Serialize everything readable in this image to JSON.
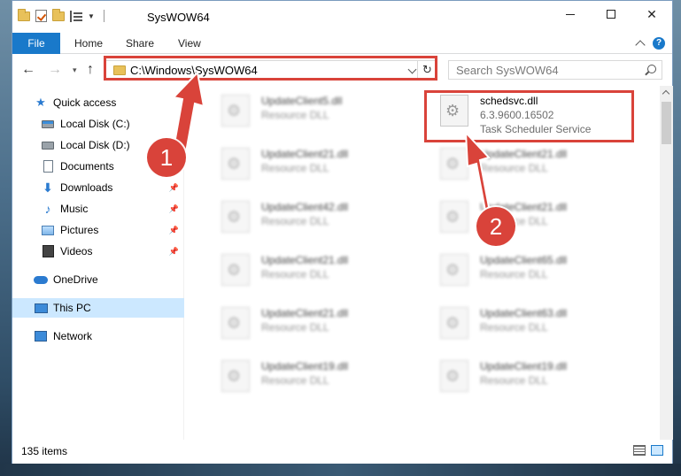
{
  "window": {
    "title": "SysWOW64",
    "controls": {
      "minimize": "",
      "maximize": "",
      "close": "✕"
    }
  },
  "ribbon": {
    "tabs": [
      {
        "label": "File"
      },
      {
        "label": "Home"
      },
      {
        "label": "Share"
      },
      {
        "label": "View"
      }
    ],
    "help": "?"
  },
  "address": {
    "path": "C:\\Windows\\SysWOW64",
    "refresh": "↻"
  },
  "search": {
    "placeholder": "Search SysWOW64"
  },
  "nav": {
    "back": "←",
    "forward": "→",
    "recent": "▾",
    "up": "↑",
    "items": [
      {
        "label": "Quick access",
        "icon": "star-icon"
      },
      {
        "label": "Local Disk (C:)",
        "icon": "disk-icon"
      },
      {
        "label": "Local Disk (D:)",
        "icon": "disk-icon"
      },
      {
        "label": "Documents",
        "icon": "document-icon"
      },
      {
        "label": "Downloads",
        "icon": "download-icon",
        "pinned": true
      },
      {
        "label": "Music",
        "icon": "music-icon",
        "pinned": true
      },
      {
        "label": "Pictures",
        "icon": "pictures-icon",
        "pinned": true
      },
      {
        "label": "Videos",
        "icon": "videos-icon",
        "pinned": true
      },
      {
        "label": "OneDrive",
        "icon": "cloud-icon"
      },
      {
        "label": "This PC",
        "icon": "pc-icon",
        "selected": true
      },
      {
        "label": "Network",
        "icon": "network-icon"
      }
    ]
  },
  "files": {
    "highlighted": {
      "name": "schedsvc.dll",
      "version": "6.3.9600.16502",
      "description": "Task Scheduler Service"
    },
    "left_column": [
      {
        "name": "UpdateClient5.dll",
        "type": "Resource DLL"
      },
      {
        "name": "UpdateClient21.dll",
        "type": "Resource DLL"
      },
      {
        "name": "UpdateClient42.dll",
        "type": "Resource DLL"
      },
      {
        "name": "UpdateClient21.dll",
        "type": "Resource DLL"
      },
      {
        "name": "UpdateClient21.dll",
        "type": "Resource DLL"
      },
      {
        "name": "UpdateClient19.dll",
        "type": "Resource DLL"
      }
    ],
    "right_column": [
      {
        "name": "UpdateClient21.dll",
        "type": "Resource DLL"
      },
      {
        "name": "UpdateClient21.dll",
        "type": "Resource DLL"
      },
      {
        "name": "UpdateClient65.dll",
        "type": "Resource DLL"
      },
      {
        "name": "UpdateClient63.dll",
        "type": "Resource DLL"
      },
      {
        "name": "UpdateClient19.dll",
        "type": "Resource DLL"
      }
    ]
  },
  "status": {
    "item_count": "135 items"
  },
  "annotations": {
    "step1": "1",
    "step2": "2",
    "color": "#d9433a"
  }
}
